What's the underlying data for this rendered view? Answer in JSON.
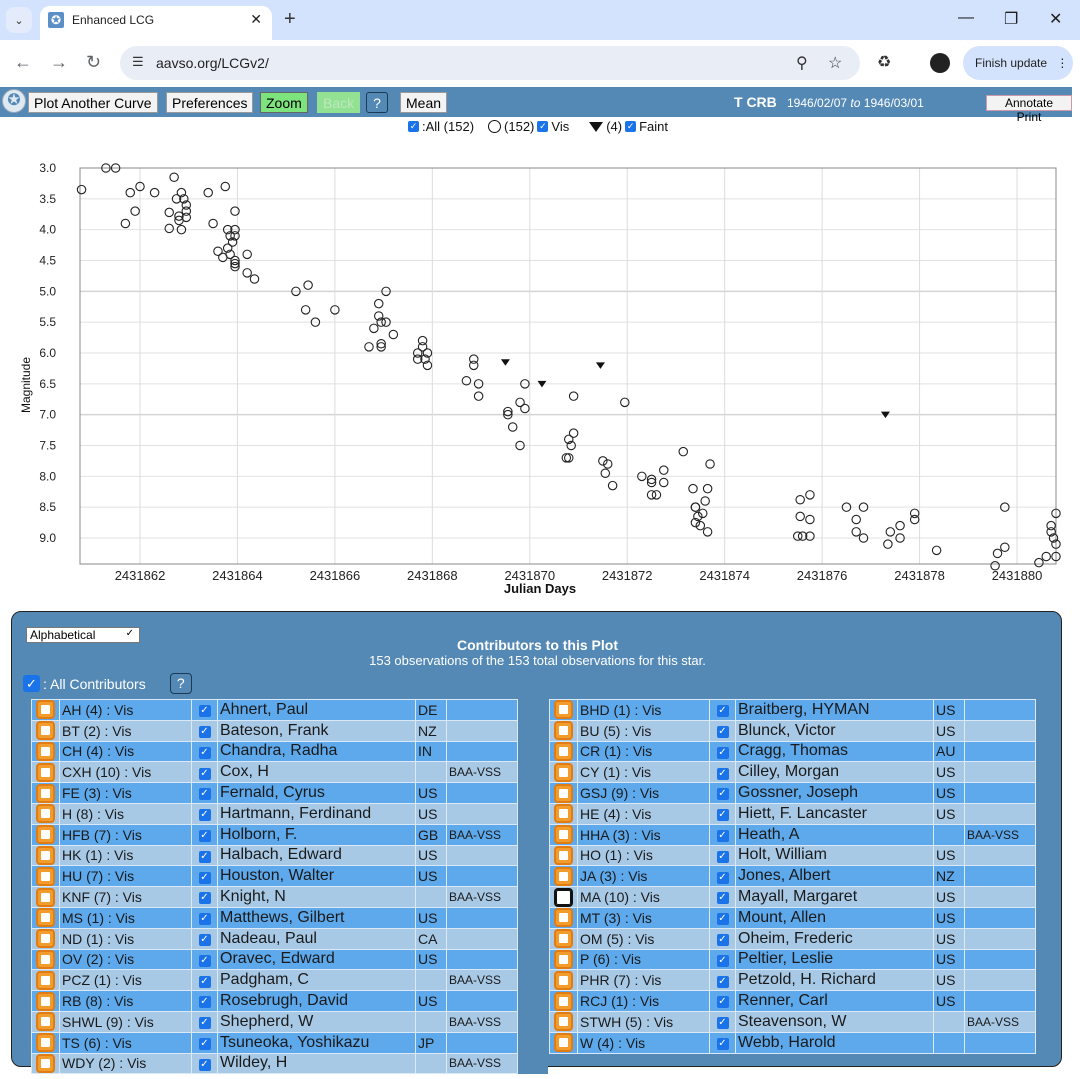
{
  "browser": {
    "tab_title": "Enhanced LCG",
    "url": "aavso.org/LCGv2/",
    "finish_update": "Finish update"
  },
  "appbar": {
    "plot_another_curve": "Plot Another Curve",
    "preferences": "Preferences",
    "zoom": "Zoom",
    "back": "Back",
    "help": "?",
    "mean": "Mean",
    "star": "T CRB",
    "date_from": "1946/02/07",
    "date_to_word": "to",
    "date_to": "1946/03/01",
    "annotate_print": "Annotate Print"
  },
  "legend": {
    "all_label": ":All (152)",
    "vis_count": "(152)",
    "vis_label": "Vis",
    "faint_count": "(4)",
    "faint_label": "Faint"
  },
  "chart_data": {
    "type": "scatter",
    "title": "",
    "xlabel": "Julian Days",
    "ylabel": "Magnitude",
    "xlim": [
      2431860.8,
      2431880.8
    ],
    "ylim": [
      3.0,
      9.45
    ],
    "y_inverted": true,
    "grid": true,
    "x_ticks": [
      2431862,
      2431864,
      2431866,
      2431868,
      2431870,
      2431872,
      2431874,
      2431876,
      2431878,
      2431880
    ],
    "x_tick_labels": [
      "2431862",
      "2431864",
      "2431866",
      "2431868",
      "2431870",
      "2431872",
      "2431874",
      "2431876",
      "2431878",
      "2431880"
    ],
    "y_ticks": [
      3.0,
      3.5,
      4.0,
      4.5,
      5.0,
      5.5,
      6.0,
      6.5,
      7.0,
      7.5,
      8.0,
      8.5,
      9.0
    ],
    "y_tick_labels": [
      "3.0",
      "3.5",
      "4.0",
      "4.5",
      "5.0",
      "5.5",
      "6.0",
      "6.5",
      "7.0",
      "7.5",
      "8.0",
      "8.5",
      "9.0"
    ],
    "series": [
      {
        "name": "Vis",
        "marker": "open-circle",
        "points": [
          [
            2431860.8,
            3.35
          ],
          [
            2431861.3,
            3.0
          ],
          [
            2431861.5,
            3.0
          ],
          [
            2431861.7,
            3.9
          ],
          [
            2431861.8,
            3.4
          ],
          [
            2431861.9,
            3.7
          ],
          [
            2431862.0,
            3.3
          ],
          [
            2431862.3,
            3.4
          ],
          [
            2431862.6,
            3.72
          ],
          [
            2431862.6,
            3.98
          ],
          [
            2431862.7,
            3.15
          ],
          [
            2431862.75,
            3.5
          ],
          [
            2431862.8,
            3.85
          ],
          [
            2431862.85,
            3.4
          ],
          [
            2431862.9,
            3.5
          ],
          [
            2431862.85,
            4.0
          ],
          [
            2431862.95,
            3.6
          ],
          [
            2431862.95,
            3.7
          ],
          [
            2431862.95,
            3.8
          ],
          [
            2431862.8,
            3.78
          ],
          [
            2431863.4,
            3.4
          ],
          [
            2431863.5,
            3.9
          ],
          [
            2431863.6,
            4.35
          ],
          [
            2431863.7,
            4.45
          ],
          [
            2431863.75,
            3.3
          ],
          [
            2431863.8,
            4.0
          ],
          [
            2431863.85,
            4.1
          ],
          [
            2431863.9,
            4.2
          ],
          [
            2431863.8,
            4.3
          ],
          [
            2431863.85,
            4.4
          ],
          [
            2431863.95,
            4.0
          ],
          [
            2431863.95,
            4.1
          ],
          [
            2431863.95,
            3.7
          ],
          [
            2431863.95,
            4.5
          ],
          [
            2431863.95,
            4.6
          ],
          [
            2431863.95,
            4.55
          ],
          [
            2431864.2,
            4.4
          ],
          [
            2431864.2,
            4.7
          ],
          [
            2431864.35,
            4.8
          ],
          [
            2431865.2,
            5.0
          ],
          [
            2431865.4,
            5.3
          ],
          [
            2431865.45,
            4.9
          ],
          [
            2431865.6,
            5.5
          ],
          [
            2431866.0,
            5.3
          ],
          [
            2431866.7,
            5.9
          ],
          [
            2431866.8,
            5.6
          ],
          [
            2431866.9,
            5.2
          ],
          [
            2431866.9,
            5.4
          ],
          [
            2431866.95,
            5.5
          ],
          [
            2431866.95,
            5.85
          ],
          [
            2431866.95,
            5.9
          ],
          [
            2431867.05,
            5.5
          ],
          [
            2431867.05,
            5.0
          ],
          [
            2431867.2,
            5.7
          ],
          [
            2431867.7,
            6.0
          ],
          [
            2431867.7,
            6.1
          ],
          [
            2431867.8,
            5.8
          ],
          [
            2431867.8,
            5.9
          ],
          [
            2431867.85,
            6.1
          ],
          [
            2431867.9,
            6.0
          ],
          [
            2431867.9,
            6.2
          ],
          [
            2431868.7,
            6.45
          ],
          [
            2431868.85,
            6.1
          ],
          [
            2431868.85,
            6.2
          ],
          [
            2431868.95,
            6.5
          ],
          [
            2431868.95,
            6.7
          ],
          [
            2431869.55,
            6.95
          ],
          [
            2431869.55,
            7.0
          ],
          [
            2431869.65,
            7.2
          ],
          [
            2431869.8,
            7.5
          ],
          [
            2431869.8,
            6.8
          ],
          [
            2431869.9,
            6.9
          ],
          [
            2431869.9,
            6.5
          ],
          [
            2431870.8,
            7.7
          ],
          [
            2431870.8,
            7.4
          ],
          [
            2431870.85,
            7.5
          ],
          [
            2431870.9,
            7.3
          ],
          [
            2431870.9,
            6.7
          ],
          [
            2431870.75,
            7.7
          ],
          [
            2431871.5,
            7.75
          ],
          [
            2431871.55,
            7.95
          ],
          [
            2431871.6,
            7.8
          ],
          [
            2431871.7,
            8.15
          ],
          [
            2431871.95,
            6.8
          ],
          [
            2431872.3,
            8.0
          ],
          [
            2431872.5,
            8.05
          ],
          [
            2431872.5,
            8.1
          ],
          [
            2431872.5,
            8.3
          ],
          [
            2431872.6,
            8.3
          ],
          [
            2431872.75,
            8.1
          ],
          [
            2431872.75,
            7.9
          ],
          [
            2431873.15,
            7.6
          ],
          [
            2431873.35,
            8.2
          ],
          [
            2431873.4,
            8.5
          ],
          [
            2431873.4,
            8.75
          ],
          [
            2431873.5,
            8.8
          ],
          [
            2431873.55,
            8.6
          ],
          [
            2431873.6,
            8.4
          ],
          [
            2431873.65,
            8.9
          ],
          [
            2431873.65,
            8.2
          ],
          [
            2431873.7,
            7.8
          ],
          [
            2431873.4,
            8.5
          ],
          [
            2431873.45,
            8.65
          ],
          [
            2431875.5,
            8.97
          ],
          [
            2431875.6,
            8.97
          ],
          [
            2431875.55,
            8.38
          ],
          [
            2431875.55,
            8.65
          ],
          [
            2431875.75,
            8.3
          ],
          [
            2431875.75,
            8.7
          ],
          [
            2431875.75,
            8.97
          ],
          [
            2431876.5,
            8.5
          ],
          [
            2431876.7,
            8.9
          ],
          [
            2431876.7,
            8.7
          ],
          [
            2431876.85,
            8.5
          ],
          [
            2431876.85,
            9.0
          ],
          [
            2431877.35,
            9.1
          ],
          [
            2431877.4,
            8.9
          ],
          [
            2431877.6,
            8.8
          ],
          [
            2431877.6,
            9.0
          ],
          [
            2431877.9,
            8.7
          ],
          [
            2431877.9,
            8.6
          ],
          [
            2431878.35,
            9.2
          ],
          [
            2431879.55,
            9.45
          ],
          [
            2431879.6,
            9.25
          ],
          [
            2431879.75,
            9.15
          ],
          [
            2431879.75,
            8.5
          ],
          [
            2431880.45,
            9.4
          ],
          [
            2431880.6,
            9.3
          ],
          [
            2431880.7,
            8.8
          ],
          [
            2431880.7,
            8.9
          ],
          [
            2431880.75,
            9.0
          ],
          [
            2431880.8,
            8.6
          ],
          [
            2431880.8,
            9.1
          ],
          [
            2431880.8,
            9.3
          ]
        ]
      },
      {
        "name": "Faint",
        "marker": "filled-down-triangle",
        "points": [
          [
            2431869.5,
            6.15
          ],
          [
            2431870.25,
            6.5
          ],
          [
            2431871.45,
            6.2
          ],
          [
            2431877.3,
            7.0
          ]
        ]
      }
    ]
  },
  "contributors": {
    "sort_option": "Alphabetical",
    "title": "Contributors to this Plot",
    "subtitle": "153 observations of the 153 total observations for this star.",
    "all_label": ": All Contributors",
    "help": "?",
    "left": [
      {
        "code": "AH (4) : Vis",
        "name": "Ahnert, Paul",
        "country": "DE",
        "org": ""
      },
      {
        "code": "BT (2) : Vis",
        "name": "Bateson, Frank",
        "country": "NZ",
        "org": ""
      },
      {
        "code": "CH (4) : Vis",
        "name": "Chandra, Radha",
        "country": "IN",
        "org": ""
      },
      {
        "code": "CXH (10) : Vis",
        "name": "Cox, H",
        "country": "",
        "org": "BAA-VSS"
      },
      {
        "code": "FE (3) : Vis",
        "name": "Fernald, Cyrus",
        "country": "US",
        "org": ""
      },
      {
        "code": "H (8) : Vis",
        "name": "Hartmann, Ferdinand",
        "country": "US",
        "org": ""
      },
      {
        "code": "HFB (7) : Vis",
        "name": "Holborn, F.",
        "country": "GB",
        "org": "BAA-VSS"
      },
      {
        "code": "HK (1) : Vis",
        "name": "Halbach, Edward",
        "country": "US",
        "org": ""
      },
      {
        "code": "HU (7) : Vis",
        "name": "Houston, Walter",
        "country": "US",
        "org": ""
      },
      {
        "code": "KNF (7) : Vis",
        "name": "Knight, N",
        "country": "",
        "org": "BAA-VSS"
      },
      {
        "code": "MS (1) : Vis",
        "name": "Matthews, Gilbert",
        "country": "US",
        "org": ""
      },
      {
        "code": "ND (1) : Vis",
        "name": "Nadeau, Paul",
        "country": "CA",
        "org": ""
      },
      {
        "code": "OV (2) : Vis",
        "name": "Oravec, Edward",
        "country": "US",
        "org": ""
      },
      {
        "code": "PCZ (1) : Vis",
        "name": "Padgham, C",
        "country": "",
        "org": "BAA-VSS"
      },
      {
        "code": "RB (8) : Vis",
        "name": "Rosebrugh, David",
        "country": "US",
        "org": ""
      },
      {
        "code": "SHWL (9) : Vis",
        "name": "Shepherd, W",
        "country": "",
        "org": "BAA-VSS"
      },
      {
        "code": "TS (6) : Vis",
        "name": "Tsuneoka, Yoshikazu",
        "country": "JP",
        "org": ""
      },
      {
        "code": "WDY (2) : Vis",
        "name": "Wildey, H",
        "country": "",
        "org": "BAA-VSS"
      }
    ],
    "right": [
      {
        "code": "BHD (1) : Vis",
        "name": "Braitberg, HYMAN",
        "country": "US",
        "org": ""
      },
      {
        "code": "BU (5) : Vis",
        "name": "Blunck, Victor",
        "country": "US",
        "org": ""
      },
      {
        "code": "CR (1) : Vis",
        "name": "Cragg, Thomas",
        "country": "AU",
        "org": ""
      },
      {
        "code": "CY (1) : Vis",
        "name": "Cilley, Morgan",
        "country": "US",
        "org": ""
      },
      {
        "code": "GSJ (9) : Vis",
        "name": "Gossner, Joseph",
        "country": "US",
        "org": ""
      },
      {
        "code": "HE (4) : Vis",
        "name": "Hiett, F. Lancaster",
        "country": "US",
        "org": ""
      },
      {
        "code": "HHA (3) : Vis",
        "name": "Heath, A",
        "country": "",
        "org": "BAA-VSS"
      },
      {
        "code": "HO (1) : Vis",
        "name": "Holt, William",
        "country": "US",
        "org": ""
      },
      {
        "code": "JA (3) : Vis",
        "name": "Jones, Albert",
        "country": "NZ",
        "org": ""
      },
      {
        "code": "MA (10) : Vis",
        "name": "Mayall, Margaret",
        "country": "US",
        "org": "",
        "selected": true
      },
      {
        "code": "MT (3) : Vis",
        "name": "Mount, Allen",
        "country": "US",
        "org": ""
      },
      {
        "code": "OM (5) : Vis",
        "name": "Oheim, Frederic",
        "country": "US",
        "org": ""
      },
      {
        "code": "P (6) : Vis",
        "name": "Peltier, Leslie",
        "country": "US",
        "org": ""
      },
      {
        "code": "PHR (7) : Vis",
        "name": "Petzold, H. Richard",
        "country": "US",
        "org": ""
      },
      {
        "code": "RCJ (1) : Vis",
        "name": "Renner, Carl",
        "country": "US",
        "org": ""
      },
      {
        "code": "STWH (5) : Vis",
        "name": "Steavenson, W",
        "country": "",
        "org": "BAA-VSS"
      },
      {
        "code": "W (4) : Vis",
        "name": "Webb, Harold",
        "country": "",
        "org": ""
      }
    ]
  }
}
